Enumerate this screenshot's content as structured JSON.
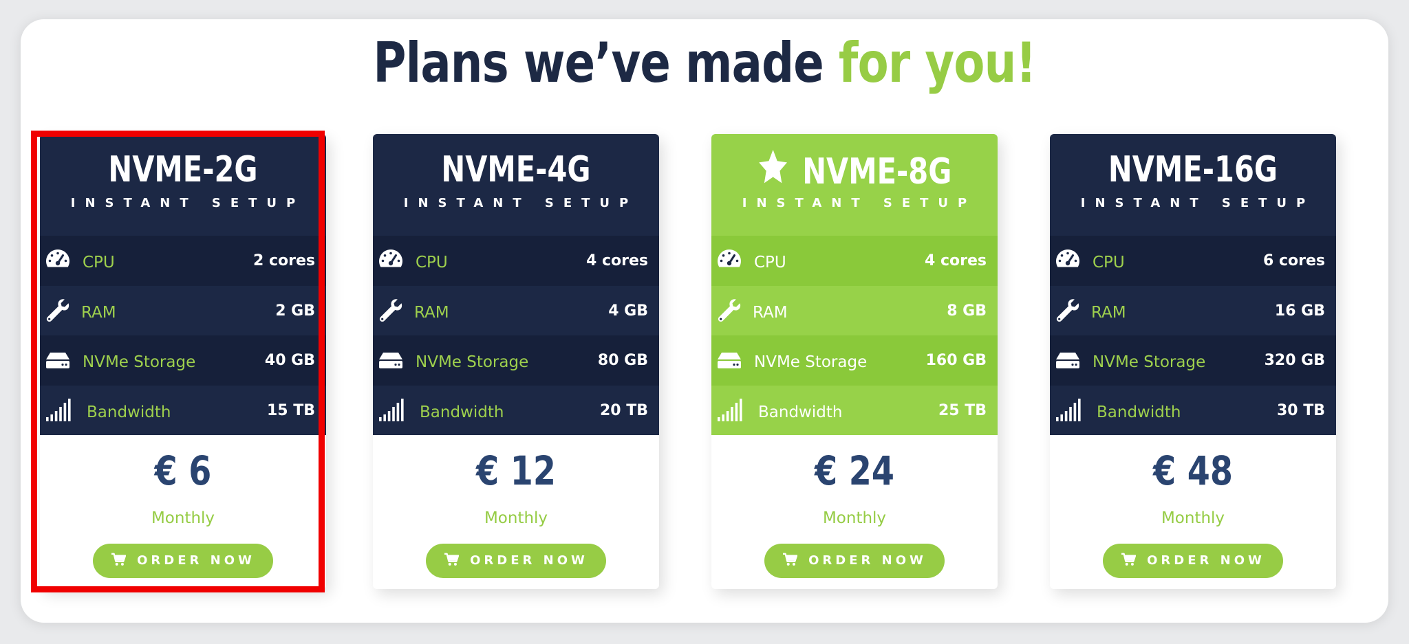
{
  "heading": {
    "main": "Plans we’ve made ",
    "accent": "for you!"
  },
  "plans": [
    {
      "name": "NVME-2G",
      "subtitle": "INSTANT SETUP",
      "featured": false,
      "specs": [
        {
          "icon": "speedometer-icon",
          "label": "CPU",
          "value": "2 cores"
        },
        {
          "icon": "wrench-icon",
          "label": "RAM",
          "value": "2 GB"
        },
        {
          "icon": "hard-drive-icon",
          "label": "NVMe Storage",
          "value": "40 GB"
        },
        {
          "icon": "signal-bars-icon",
          "label": "Bandwidth",
          "value": "15 TB"
        }
      ],
      "price": "€ 6",
      "period": "Monthly",
      "button": "ORDER NOW"
    },
    {
      "name": "NVME-4G",
      "subtitle": "INSTANT SETUP",
      "featured": false,
      "specs": [
        {
          "icon": "speedometer-icon",
          "label": "CPU",
          "value": "4 cores"
        },
        {
          "icon": "wrench-icon",
          "label": "RAM",
          "value": "4 GB"
        },
        {
          "icon": "hard-drive-icon",
          "label": "NVMe Storage",
          "value": "80 GB"
        },
        {
          "icon": "signal-bars-icon",
          "label": "Bandwidth",
          "value": "20 TB"
        }
      ],
      "price": "€ 12",
      "period": "Monthly",
      "button": "ORDER NOW"
    },
    {
      "name": "NVME-8G",
      "subtitle": "INSTANT SETUP",
      "featured": true,
      "specs": [
        {
          "icon": "speedometer-icon",
          "label": "CPU",
          "value": "4 cores"
        },
        {
          "icon": "wrench-icon",
          "label": "RAM",
          "value": "8 GB"
        },
        {
          "icon": "hard-drive-icon",
          "label": "NVMe Storage",
          "value": "160 GB"
        },
        {
          "icon": "signal-bars-icon",
          "label": "Bandwidth",
          "value": "25 TB"
        }
      ],
      "price": "€ 24",
      "period": "Monthly",
      "button": "ORDER NOW"
    },
    {
      "name": "NVME-16G",
      "subtitle": "INSTANT SETUP",
      "featured": false,
      "specs": [
        {
          "icon": "speedometer-icon",
          "label": "CPU",
          "value": "6 cores"
        },
        {
          "icon": "wrench-icon",
          "label": "RAM",
          "value": "16 GB"
        },
        {
          "icon": "hard-drive-icon",
          "label": "NVMe Storage",
          "value": "320 GB"
        },
        {
          "icon": "signal-bars-icon",
          "label": "Bandwidth",
          "value": "30 TB"
        }
      ],
      "price": "€ 48",
      "period": "Monthly",
      "button": "ORDER NOW"
    }
  ],
  "colors": {
    "navy": "#1c2845",
    "navy_dark": "#16203a",
    "green": "#97cc45",
    "price": "#2a4470",
    "highlight": "#f00000"
  }
}
